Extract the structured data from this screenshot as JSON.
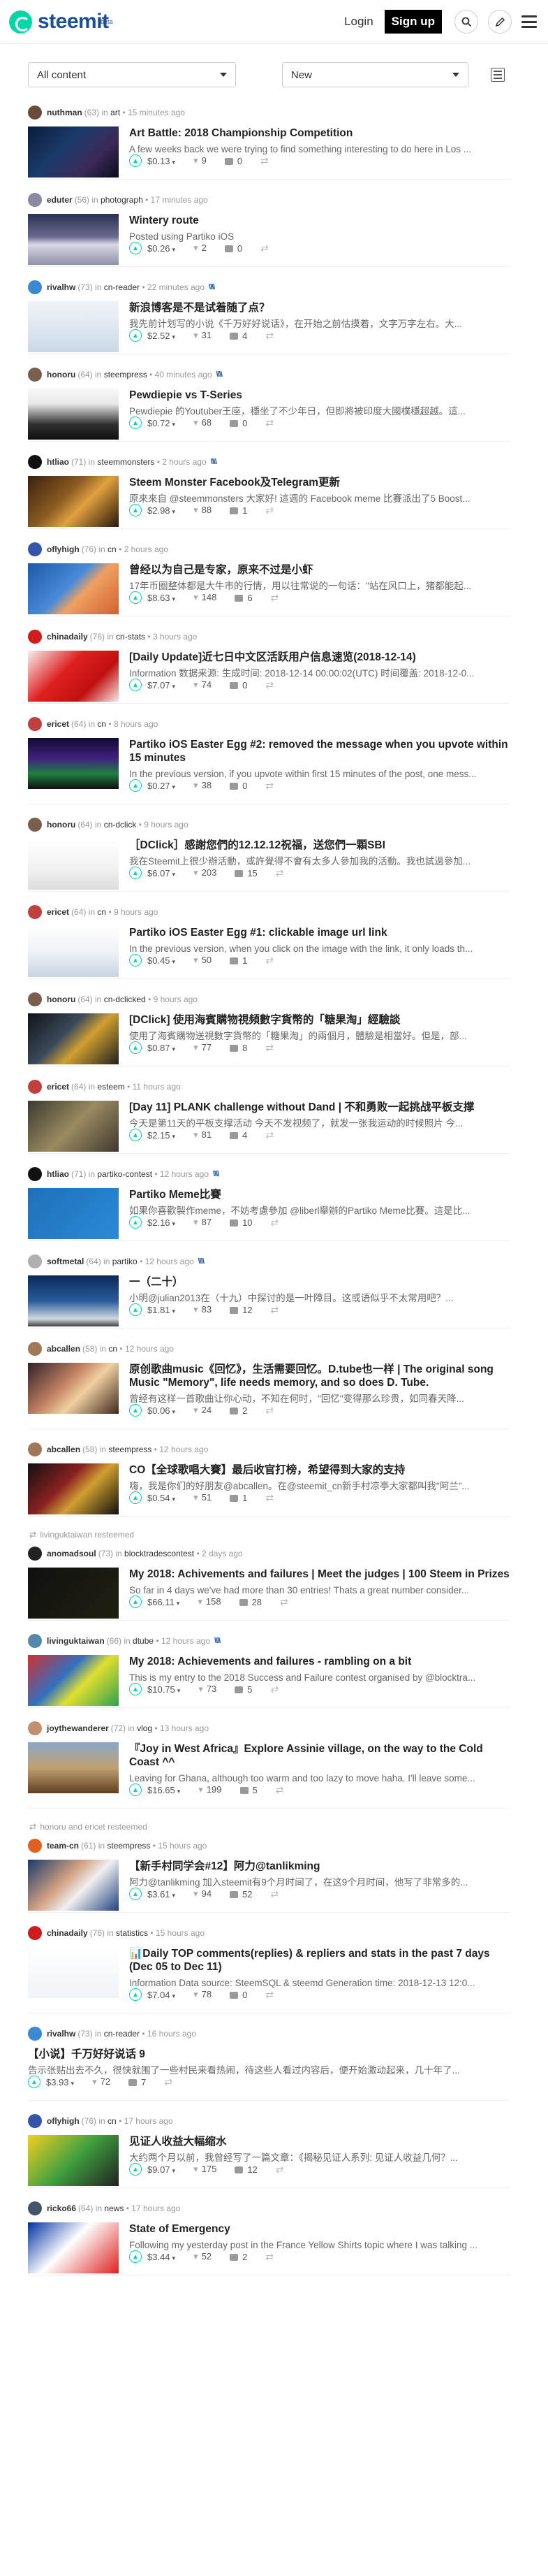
{
  "header": {
    "logo_text": "steemit",
    "logo_badge": "beta",
    "login_label": "Login",
    "signup_label": "Sign up",
    "search_icon": "search-icon",
    "pencil_icon": "pencil-icon",
    "menu_icon": "hamburger-menu-icon"
  },
  "filters": {
    "content_select": "All content",
    "sort_select": "New"
  },
  "colors": {
    "accent": "#07d6a8",
    "brand": "#1a5099"
  },
  "posts": [
    {
      "reblog": "",
      "author": "nuthman",
      "rep": "(63)",
      "cat": "art",
      "time": "• 15 minutes ago",
      "promo": "",
      "title": "Art Battle: 2018 Championship Competition",
      "excerpt": "A few weeks back we were trying to find something interesting to do here in Los ...",
      "payout": "$0.13",
      "votes": "9",
      "comments": "0",
      "thumb": "t1",
      "avatar": "#6a4a3a"
    },
    {
      "reblog": "",
      "author": "eduter",
      "rep": "(56)",
      "cat": "photograph",
      "time": "• 17 minutes ago",
      "promo": "",
      "title": "Wintery route",
      "excerpt": "Posted using Partiko iOS",
      "payout": "$0.26",
      "votes": "2",
      "comments": "0",
      "thumb": "t2",
      "avatar": "#8a8aa0"
    },
    {
      "reblog": "",
      "author": "rivalhw",
      "rep": "(73)",
      "cat": "cn-reader",
      "time": "• 22 minutes ago",
      "promo": "\\\\\\\\",
      "title": "新浪博客是不是试着随了点？",
      "excerpt": "我先前计划写的小说《千万好好说话》，在开始之前估摸着，文字万字左右。大...",
      "payout": "$2.52",
      "votes": "31",
      "comments": "4",
      "thumb": "t3",
      "avatar": "#3b8ad0"
    },
    {
      "reblog": "",
      "author": "honoru",
      "rep": "(64)",
      "cat": "steempress",
      "time": "• 40 minutes ago",
      "promo": "\\\\\\\\",
      "title": "Pewdiepie vs T-Series",
      "excerpt": "Pewdiepie 的Youtuber王座，穩坐了不少年日，但即將被印度大國樸穩超越。這...",
      "payout": "$0.72",
      "votes": "68",
      "comments": "0",
      "thumb": "t4",
      "avatar": "#7a5e4e"
    },
    {
      "reblog": "",
      "author": "htliao",
      "rep": "(71)",
      "cat": "steemmonsters",
      "time": "• 2 hours ago",
      "promo": "\\\\\\\\",
      "title": "Steem Monster Facebook及Telegram更新",
      "excerpt": "原來來自 @steemmonsters 大家好! 這週的 Facebook meme 比賽派出了5 Boost...",
      "payout": "$2.98",
      "votes": "88",
      "comments": "1",
      "thumb": "t5",
      "avatar": "#111111"
    },
    {
      "reblog": "",
      "author": "oflyhigh",
      "rep": "(76)",
      "cat": "cn",
      "time": "• 2 hours ago",
      "promo": "",
      "title": "曾经以为自己是专家，原来不过是小虾",
      "excerpt": "17年币圈整体都是大牛市的行情，用以往常说的一句话：\"站在风口上，猪都能起...",
      "payout": "$8.63",
      "votes": "148",
      "comments": "6",
      "thumb": "t6",
      "avatar": "#3355aa"
    },
    {
      "reblog": "",
      "author": "chinadaily",
      "rep": "(76)",
      "cat": "cn-stats",
      "time": "• 3 hours ago",
      "promo": "",
      "title": "[Daily Update]近七日中文区活跃用户信息速览(2018-12-14)",
      "excerpt": "Information 数据来源: 生成时间: 2018-12-14 00:00:02(UTC) 时间覆盖: 2018-12-0...",
      "payout": "$7.07",
      "votes": "74",
      "comments": "0",
      "thumb": "t7",
      "avatar": "#d01c1c"
    },
    {
      "reblog": "",
      "author": "ericet",
      "rep": "(64)",
      "cat": "cn",
      "time": "• 8 hours ago",
      "promo": "",
      "title": "Partiko iOS Easter Egg #2: removed the message when you upvote within 15 minutes",
      "excerpt": "In the previous version, if you upvote within first 15 minutes of the post, one mess...",
      "payout": "$0.27",
      "votes": "38",
      "comments": "0",
      "thumb": "t8",
      "avatar": "#c04040"
    },
    {
      "reblog": "",
      "author": "honoru",
      "rep": "(64)",
      "cat": "cn-dclick",
      "time": "• 9 hours ago",
      "promo": "",
      "title": "［DClick］感謝您們的12.12.12祝福，送您們一顆SBI",
      "excerpt": "我在Steemit上很少辦活動，或許覺得不會有太多人參加我的活動。我也試過參加...",
      "payout": "$6.07",
      "votes": "203",
      "comments": "15",
      "thumb": "t9",
      "avatar": "#7a5e4e"
    },
    {
      "reblog": "",
      "author": "ericet",
      "rep": "(64)",
      "cat": "cn",
      "time": "• 9 hours ago",
      "promo": "",
      "title": "Partiko iOS Easter Egg #1: clickable image url link",
      "excerpt": "In the previous version, when you click on the image with the link, it only loads th...",
      "payout": "$0.45",
      "votes": "50",
      "comments": "1",
      "thumb": "t10",
      "avatar": "#c04040"
    },
    {
      "reblog": "",
      "author": "honoru",
      "rep": "(64)",
      "cat": "cn-dclicked",
      "time": "• 9 hours ago",
      "promo": "",
      "title": "[DClick] 使用海賓購物視頻數字貨幣的「糖果淘」經驗談",
      "excerpt": "使用了海賓購物送視數字貨幣的「糖果淘」的兩個月，體驗是相當好。但是，部...",
      "payout": "$0.87",
      "votes": "77",
      "comments": "8",
      "thumb": "t11",
      "avatar": "#7a5e4e"
    },
    {
      "reblog": "",
      "author": "ericet",
      "rep": "(64)",
      "cat": "esteem",
      "time": "• 11 hours ago",
      "promo": "",
      "title": "[Day 11] PLANK challenge without Dand | 不和勇败一起挑战平板支撑",
      "excerpt": "今天是第11天的平板支撑活动 今天不发视频了，就发一张我运动的时候照片 今...",
      "payout": "$2.15",
      "votes": "81",
      "comments": "4",
      "thumb": "t12",
      "avatar": "#c04040"
    },
    {
      "reblog": "",
      "author": "htliao",
      "rep": "(71)",
      "cat": "partiko-contest",
      "time": "• 12 hours ago",
      "promo": "\\\\\\\\",
      "title": "Partiko Meme比賽",
      "excerpt": "如果你喜歡製作meme，不妨考慮參加 @liberl舉辦的Partiko Meme比賽。這是比...",
      "payout": "$2.16",
      "votes": "87",
      "comments": "10",
      "thumb": "t13",
      "avatar": "#111111"
    },
    {
      "reblog": "",
      "author": "softmetal",
      "rep": "(64)",
      "cat": "partiko",
      "time": "• 12 hours ago",
      "promo": "\\\\\\\\",
      "title": "一（二十）",
      "excerpt": "小明@julian2013在（十九）中探讨的是一叶障目。这或语似乎不太常用吧？...",
      "payout": "$1.81",
      "votes": "83",
      "comments": "12",
      "thumb": "t14",
      "avatar": "#b0b0b0"
    },
    {
      "reblog": "",
      "author": "abcallen",
      "rep": "(58)",
      "cat": "cn",
      "time": "• 12 hours ago",
      "promo": "",
      "title": "原创歌曲music《回忆》，生活需要回忆。D.tube也一样 | The original song Music \"Memory\", life needs memory, and so does D. Tube.",
      "excerpt": "曾经有这样一首歌曲让你心动，不知在何时，\"回忆\"变得那么珍贵，如同春天降...",
      "payout": "$0.06",
      "votes": "24",
      "comments": "2",
      "thumb": "t15",
      "avatar": "#a07858"
    },
    {
      "reblog": "",
      "author": "abcallen",
      "rep": "(58)",
      "cat": "steempress",
      "time": "• 12 hours ago",
      "promo": "",
      "title": "CO【全球歌唱大賽】最后收官打榜，希望得到大家的支持",
      "excerpt": "嗨，我是你们的好朋友@abcallen。在@steemit_cn新手村凉亭大家都叫我\"阿兰\"...",
      "payout": "$0.54",
      "votes": "51",
      "comments": "1",
      "thumb": "t16",
      "avatar": "#a07858"
    },
    {
      "reblog": "livinguktaiwan resteemed",
      "author": "anomadsoul",
      "rep": "(73)",
      "cat": "blocktradescontest",
      "time": "• 2 days ago",
      "promo": "",
      "title": "My 2018: Achivements and failures | Meet the judges | 100 Steem in Prizes",
      "excerpt": "So far in 4 days we've had more than 30 entries! Thats a great number consider...",
      "payout": "$66.11",
      "votes": "158",
      "comments": "28",
      "thumb": "t17",
      "avatar": "#222222"
    },
    {
      "reblog": "",
      "author": "livinguktaiwan",
      "rep": "(66)",
      "cat": "dtube",
      "time": "• 12 hours ago",
      "promo": "\\\\\\\\",
      "title": "My 2018: Achievements and failures - rambling on a bit",
      "excerpt": "This is my entry to the 2018 Success and Failure contest organised by @blocktra...",
      "payout": "$10.75",
      "votes": "73",
      "comments": "5",
      "thumb": "t18",
      "avatar": "#5588aa"
    },
    {
      "reblog": "",
      "author": "joythewanderer",
      "rep": "(72)",
      "cat": "vlog",
      "time": "• 13 hours ago",
      "promo": "",
      "title": "『Joy in West Africa』Explore Assinie village, on the way to the Cold Coast ^^",
      "excerpt": "Leaving for Ghana, although too warm and too lazy to move haha. I'll leave some...",
      "payout": "$16.65",
      "votes": "199",
      "comments": "5",
      "thumb": "t19",
      "avatar": "#c09070"
    },
    {
      "reblog": "honoru and ericet resteemed",
      "author": "team-cn",
      "rep": "(61)",
      "cat": "steempress",
      "time": "• 15 hours ago",
      "promo": "",
      "title": "【新手村同学会#12】阿力@tanlikming",
      "excerpt": "阿力@tanlikming 加入steemit有9个月时间了，在这9个月时间，他写了非常多的...",
      "payout": "$3.61",
      "votes": "94",
      "comments": "52",
      "thumb": "t20",
      "avatar": "#e06020"
    },
    {
      "reblog": "",
      "author": "chinadaily",
      "rep": "(76)",
      "cat": "statistics",
      "time": "• 15 hours ago",
      "promo": "",
      "title": "📊Daily TOP comments(replies) & repliers and stats in the past 7 days (Dec 05 to Dec 11)",
      "excerpt": "Information Data source: SteemSQL & steemd Generation time: 2018-12-13 12:0...",
      "payout": "$7.04",
      "votes": "78",
      "comments": "0",
      "thumb": "t21",
      "avatar": "#d01c1c"
    },
    {
      "reblog": "",
      "author": "rivalhw",
      "rep": "(73)",
      "cat": "cn-reader",
      "time": "• 16 hours ago",
      "promo": "",
      "title": "【小说】千万好好说话 9",
      "excerpt": "告示张贴出去不久，很快就围了一些村民来看热闹，待这些人看过内容后，便开始激动起来，几十年了...",
      "payout": "$3.93",
      "votes": "72",
      "comments": "7",
      "thumb": "",
      "avatar": "#3b8ad0"
    },
    {
      "reblog": "",
      "author": "oflyhigh",
      "rep": "(76)",
      "cat": "cn",
      "time": "• 17 hours ago",
      "promo": "",
      "title": "见证人收益大幅缩水",
      "excerpt": "大约两个月以前，我曾经写了一篇文章：《揭秘见证人系列: 见证人收益几何？...",
      "payout": "$9.07",
      "votes": "175",
      "comments": "12",
      "thumb": "t23",
      "avatar": "#3355aa"
    },
    {
      "reblog": "",
      "author": "ricko66",
      "rep": "(64)",
      "cat": "news",
      "time": "• 17 hours ago",
      "promo": "",
      "title": "State of Emergency",
      "excerpt": "Following my yesterday post in the France Yellow Shirts topic where I was talking ...",
      "payout": "$3.44",
      "votes": "52",
      "comments": "2",
      "thumb": "t24",
      "avatar": "#445566"
    }
  ]
}
